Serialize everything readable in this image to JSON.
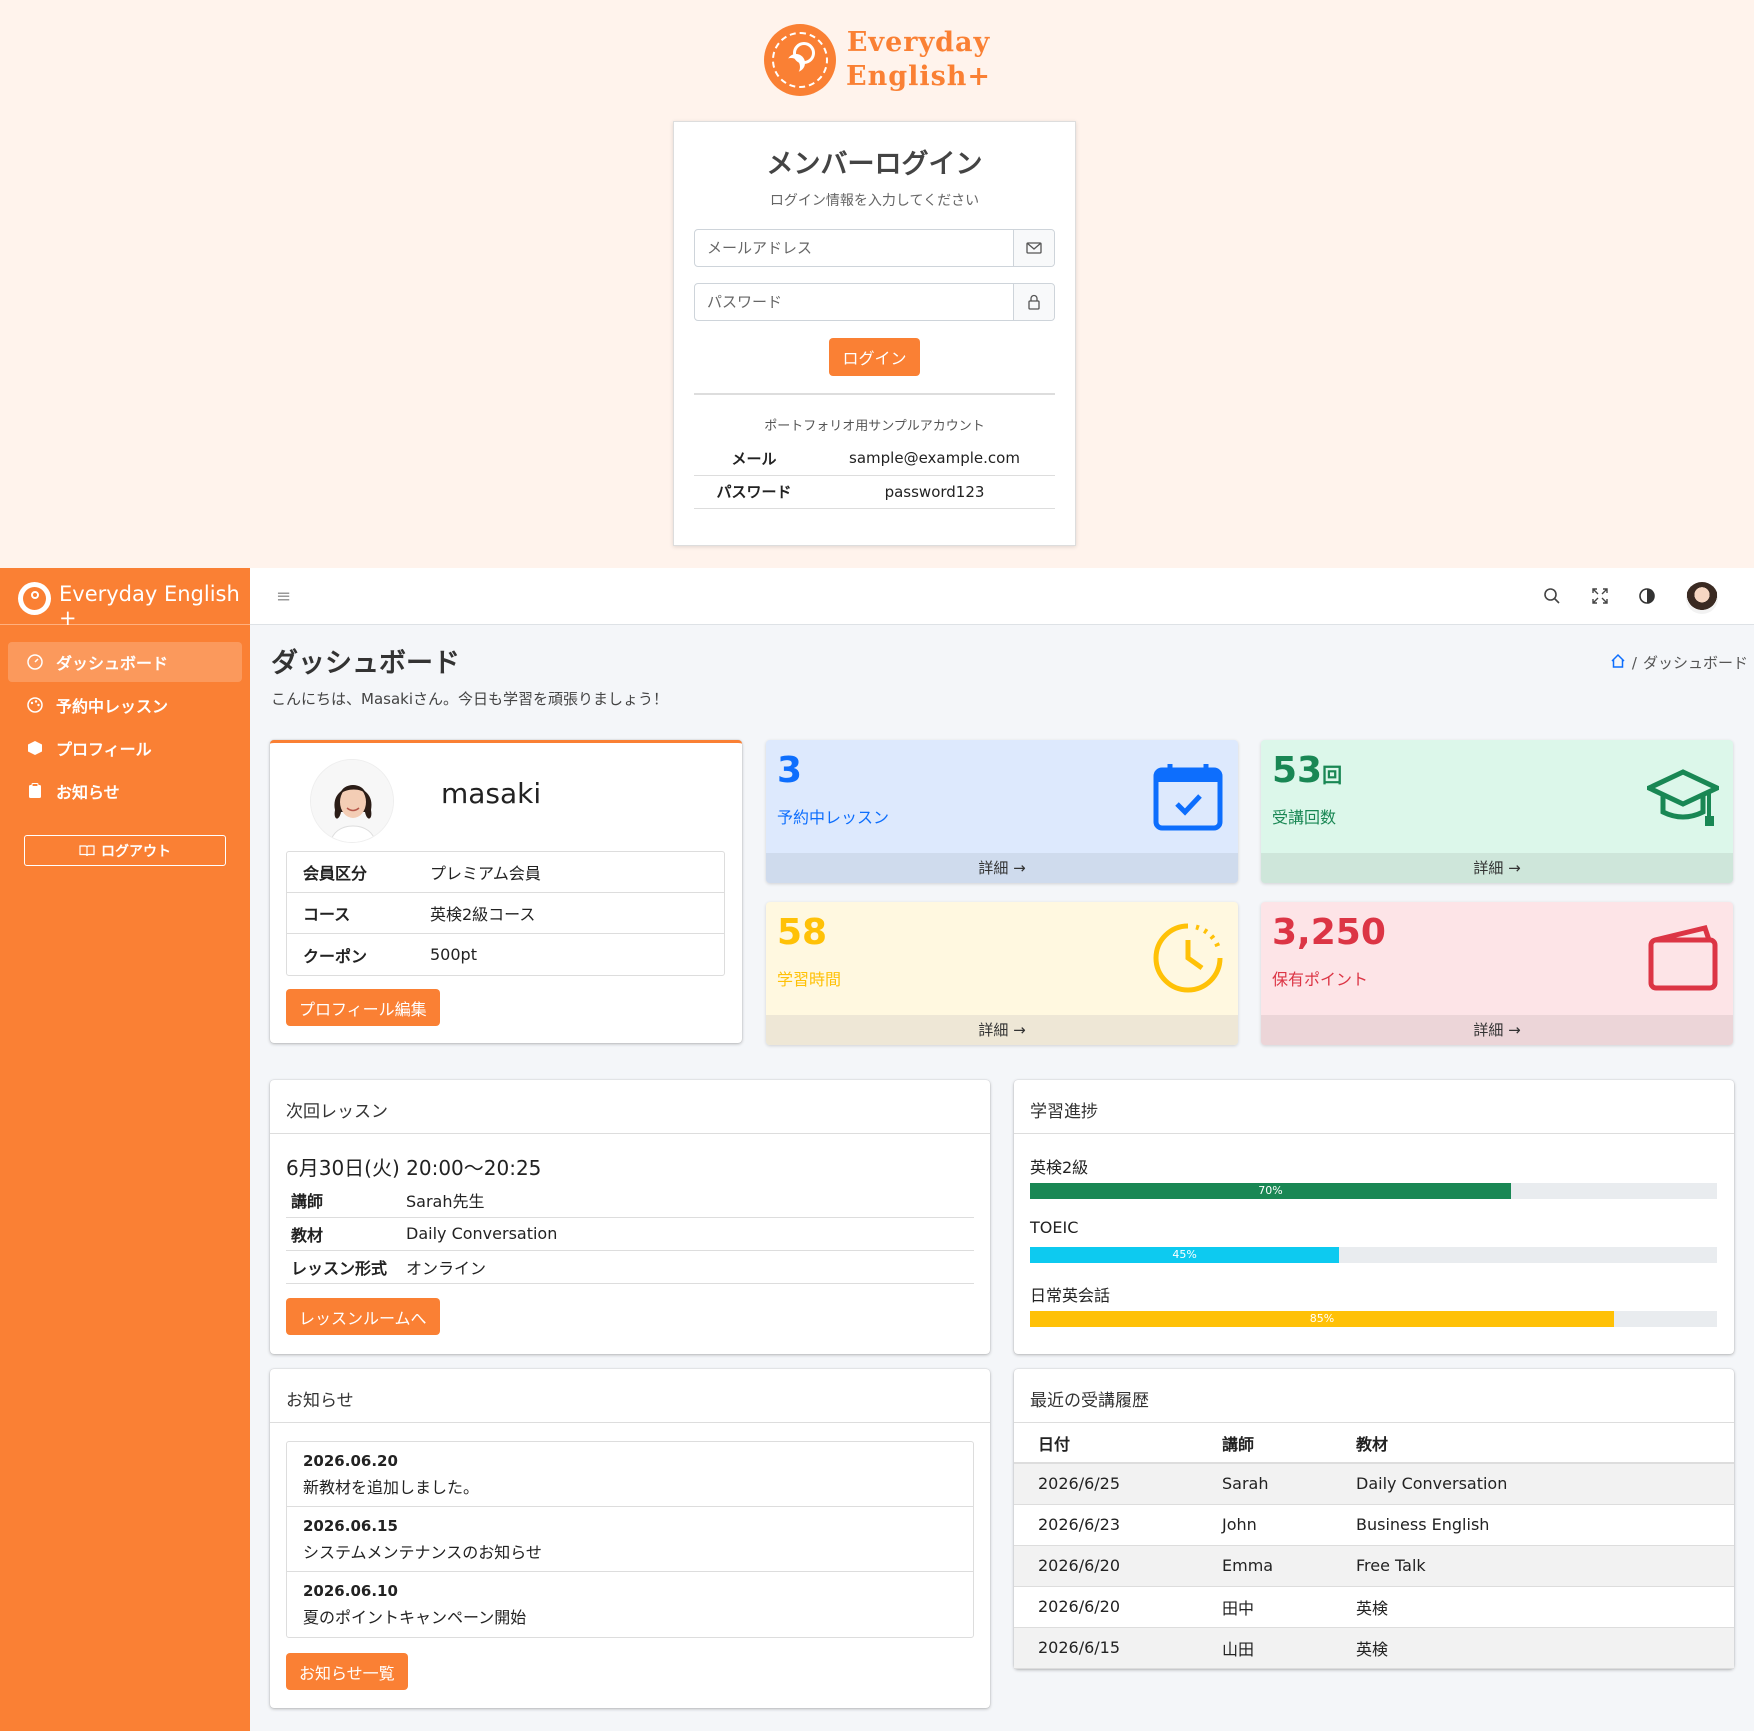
{
  "login": {
    "logo_line1": "Everyday",
    "logo_line2": "English+",
    "title": "メンバーログイン",
    "subtitle": "ログイン情報を入力してください",
    "email_placeholder": "メールアドレス",
    "password_placeholder": "パスワード",
    "login_button": "ログイン",
    "sample_label": "ポートフォリオ用サンプルアカウント",
    "sample": [
      {
        "key": "メール",
        "value": "sample@example.com"
      },
      {
        "key": "パスワード",
        "value": "password123"
      }
    ]
  },
  "sidebar": {
    "brand": "Everyday English +",
    "items": [
      {
        "label": "ダッシュボード",
        "icon": "gauge-icon"
      },
      {
        "label": "予約中レッスン",
        "icon": "palette-icon"
      },
      {
        "label": "プロフィール",
        "icon": "box-icon"
      },
      {
        "label": "お知らせ",
        "icon": "clipboard-icon"
      }
    ],
    "logout": "ログアウト"
  },
  "header": {
    "title": "ダッシュボード",
    "greeting": "こんにちは、Masakiさん。今日も学習を頑張りましょう！",
    "breadcrumb": "ダッシュボード"
  },
  "profile": {
    "name": "masaki",
    "rows": [
      {
        "key": "会員区分",
        "value": "プレミアム会員"
      },
      {
        "key": "コース",
        "value": "英検2級コース"
      },
      {
        "key": "クーポン",
        "value": "500pt"
      }
    ],
    "edit_button": "プロフィール編集"
  },
  "stats": [
    {
      "value": "3",
      "unit": "",
      "label": "予約中レッスン",
      "footer": "詳細 →",
      "color": "#0d6efd"
    },
    {
      "value": "53",
      "unit": "回",
      "label": "受講回数",
      "footer": "詳細 →",
      "color": "#198754"
    },
    {
      "value": "58",
      "unit": "",
      "label": "学習時間",
      "footer": "詳細 →",
      "color": "#ffc107"
    },
    {
      "value": "3,250",
      "unit": "",
      "label": "保有ポイント",
      "footer": "詳細 →",
      "color": "#dc3545"
    }
  ],
  "next_lesson": {
    "header": "次回レッスン",
    "datetime": "6月30日(火) 20:00〜20:25",
    "rows": [
      {
        "key": "講師",
        "value": "Sarah先生"
      },
      {
        "key": "教材",
        "value": "Daily Conversation"
      },
      {
        "key": "レッスン形式",
        "value": "オンライン"
      }
    ],
    "button": "レッスンルームへ"
  },
  "progress": {
    "header": "学習進捗",
    "items": [
      {
        "label": "英検2級",
        "percent": 70,
        "text": "70%",
        "color": "#198754"
      },
      {
        "label": "TOEIC",
        "percent": 45,
        "text": "45%",
        "color": "#0dcaf0"
      },
      {
        "label": "日常英会話",
        "percent": 85,
        "text": "85%",
        "color": "#ffc107"
      }
    ]
  },
  "news": {
    "header": "お知らせ",
    "items": [
      {
        "date": "2026.06.20",
        "text": "新教材を追加しました。"
      },
      {
        "date": "2026.06.15",
        "text": "システムメンテナンスのお知らせ"
      },
      {
        "date": "2026.06.10",
        "text": "夏のポイントキャンペーン開始"
      }
    ],
    "button": "お知らせ一覧"
  },
  "history": {
    "header": "最近の受講履歴",
    "columns": [
      "日付",
      "講師",
      "教材"
    ],
    "rows": [
      [
        "2026/6/25",
        "Sarah",
        "Daily Conversation"
      ],
      [
        "2026/6/23",
        "John",
        "Business English"
      ],
      [
        "2026/6/20",
        "Emma",
        "Free Talk"
      ],
      [
        "2026/6/20",
        "田中",
        "英検"
      ],
      [
        "2026/6/15",
        "山田",
        "英検"
      ]
    ]
  }
}
